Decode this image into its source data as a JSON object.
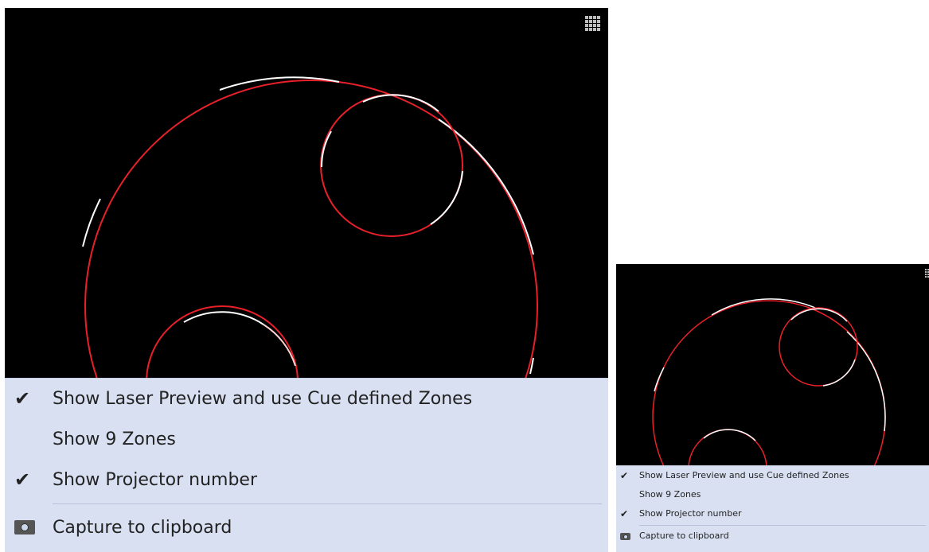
{
  "menu": {
    "items": [
      {
        "label": "Show Laser Preview and use Cue defined Zones",
        "checked": true
      },
      {
        "label": "Show 9 Zones",
        "checked": false
      },
      {
        "label": "Show Projector number",
        "checked": true
      }
    ],
    "capture_label": "Capture to clipboard"
  },
  "icons": {
    "check": "checkmark-icon",
    "capture": "camera-icon",
    "zones": "grid-icon"
  },
  "colors": {
    "preview_background": "#000000",
    "laser_red": "#e8202a",
    "laser_white": "#ffffff",
    "menu_background": "#d8e0f2"
  }
}
